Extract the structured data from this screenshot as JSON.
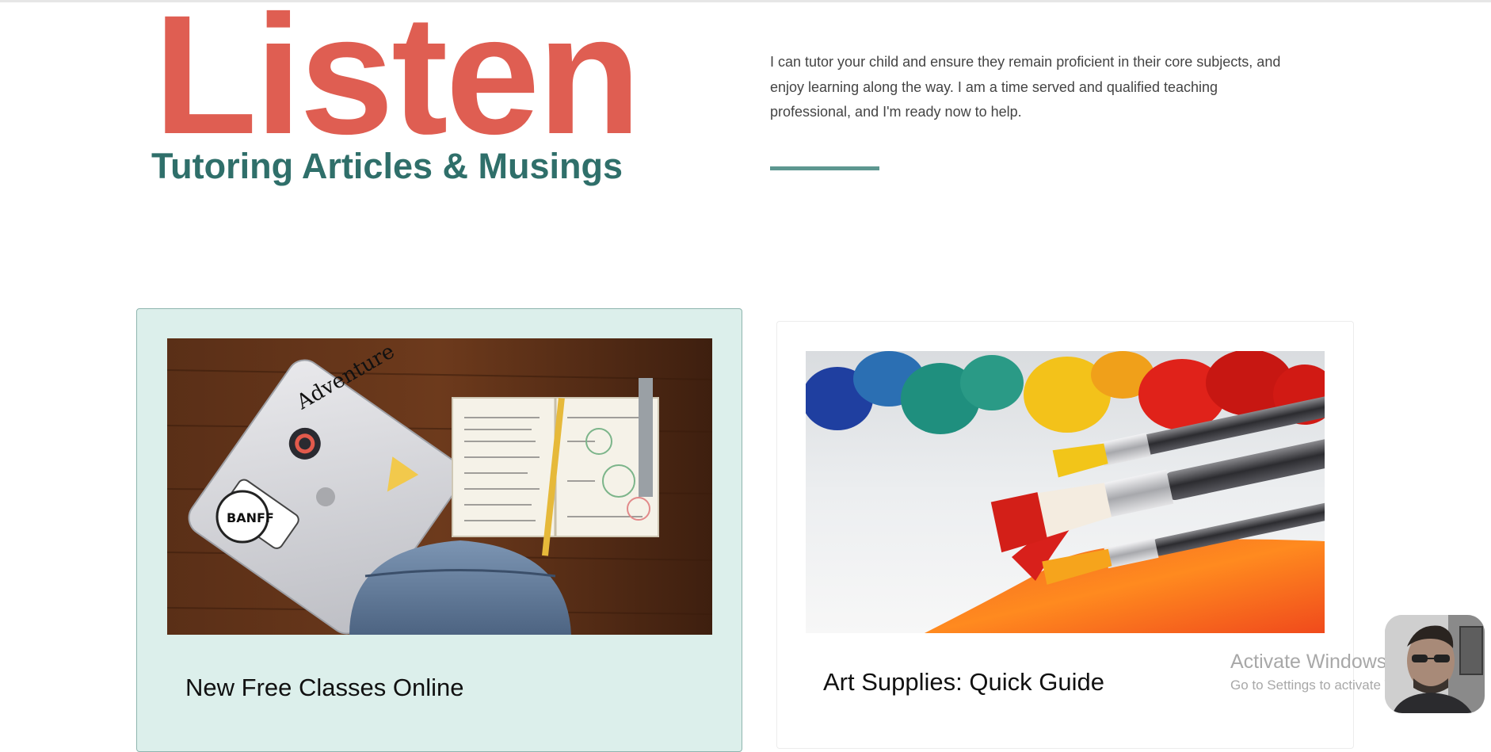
{
  "header": {
    "title": "Listen",
    "subtitle": "Tutoring Articles & Musings",
    "intro": "I can tutor your child and ensure they remain proficient in their core subjects, and enjoy learning along the way. I am a time served and qualified teaching professional, and I'm ready now to help."
  },
  "posts": [
    {
      "title": "New Free Classes Online",
      "image": "laptop-notebook-backpack-photo",
      "highlighted": true
    },
    {
      "title": "Art Supplies: Quick Guide",
      "image": "paint-brushes-photo",
      "highlighted": false
    }
  ],
  "watermark": {
    "title": "Activate Windows",
    "subtitle": "Go to Settings to activate Windows."
  },
  "video_overlay": {
    "icon": "webcam-person-avatar"
  },
  "colors": {
    "title_red": "#df5e52",
    "subtitle_teal": "#2f6f6a",
    "divider_teal": "#5d9790",
    "card_highlight_bg": "#dcefeb",
    "card_highlight_border": "#8fb5af",
    "intro_text": "#444444"
  }
}
